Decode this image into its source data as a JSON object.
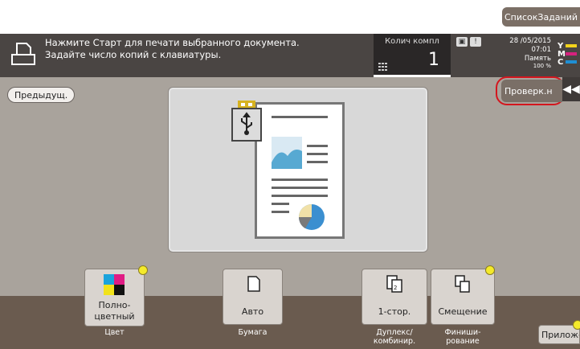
{
  "header": {
    "job_list_label": "СписокЗаданий",
    "message_line1": "Нажмите Старт для печати выбранного документа.",
    "message_line2": "Задайте число копий с клавиатуры.",
    "copies_label": "Колич компл",
    "copies_value": "1",
    "date": "28 /05/2015",
    "time": "07:01",
    "memory_label": "Память",
    "memory_value": "100 %",
    "toner": [
      {
        "letter": "Y",
        "color": "#f2d31b"
      },
      {
        "letter": "M",
        "color": "#d6217e"
      },
      {
        "letter": "C",
        "color": "#1f8fd4"
      }
    ]
  },
  "content": {
    "prev_label": "Предыдущ.",
    "check_label": "Проверк.н",
    "collapse_icon": "◀◀"
  },
  "functions": {
    "color": {
      "label1": "Полно-",
      "label2": "цветный",
      "sub": "Цвет"
    },
    "paper": {
      "label": "Авто",
      "sub": "Бумага"
    },
    "duplex": {
      "label": "1-стор.",
      "sub1": "Дуплекс/",
      "sub2": "комбинир."
    },
    "finish": {
      "label": "Смещение",
      "sub1": "Финиши-",
      "sub2": "рование"
    }
  },
  "app_label": "Приложение",
  "colors": {
    "status_bar": "#4a4543",
    "content_bg": "#a9a39c",
    "bottom_bg": "#6a5b4f",
    "highlight": "#d4161e"
  }
}
